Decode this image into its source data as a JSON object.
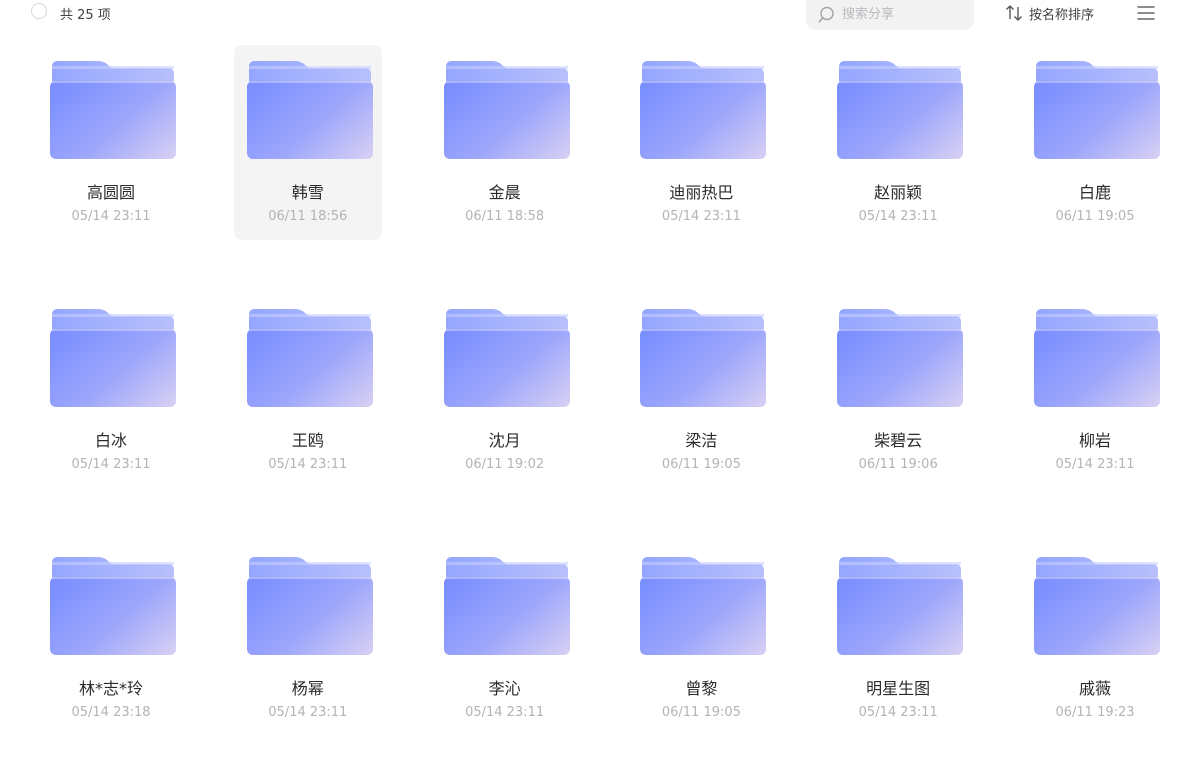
{
  "header": {
    "count_label": "共 25 项",
    "search_placeholder": "搜索分享",
    "sort_label": "按名称排序"
  },
  "colors": {
    "folder_front_start": "#7b8fff",
    "folder_front_end": "#cfcaf5",
    "folder_back": "#9eaefe",
    "selected_tile_bg": "#f4f4f5"
  },
  "icons": {
    "search": "search-icon",
    "sort": "sort-arrows-icon",
    "menu": "hamburger-menu-icon",
    "folder": "folder-icon"
  },
  "folders": [
    {
      "name": "高圆圆",
      "date": "05/14 23:11",
      "selected": false
    },
    {
      "name": "韩雪",
      "date": "06/11 18:56",
      "selected": true
    },
    {
      "name": "金晨",
      "date": "06/11 18:58",
      "selected": false
    },
    {
      "name": "迪丽热巴",
      "date": "05/14 23:11",
      "selected": false
    },
    {
      "name": "赵丽颖",
      "date": "05/14 23:11",
      "selected": false
    },
    {
      "name": "白鹿",
      "date": "06/11 19:05",
      "selected": false
    },
    {
      "name": "白冰",
      "date": "05/14 23:11",
      "selected": false
    },
    {
      "name": "王鸥",
      "date": "05/14 23:11",
      "selected": false
    },
    {
      "name": "沈月",
      "date": "06/11 19:02",
      "selected": false
    },
    {
      "name": "梁洁",
      "date": "06/11 19:05",
      "selected": false
    },
    {
      "name": "柴碧云",
      "date": "06/11 19:06",
      "selected": false
    },
    {
      "name": "柳岩",
      "date": "05/14 23:11",
      "selected": false
    },
    {
      "name": "林*志*玲",
      "date": "05/14 23:18",
      "selected": false
    },
    {
      "name": "杨幂",
      "date": "05/14 23:11",
      "selected": false
    },
    {
      "name": "李沁",
      "date": "05/14 23:11",
      "selected": false
    },
    {
      "name": "曾黎",
      "date": "06/11 19:05",
      "selected": false
    },
    {
      "name": "明星生图",
      "date": "05/14 23:11",
      "selected": false
    },
    {
      "name": "戚薇",
      "date": "06/11 19:23",
      "selected": false
    }
  ]
}
